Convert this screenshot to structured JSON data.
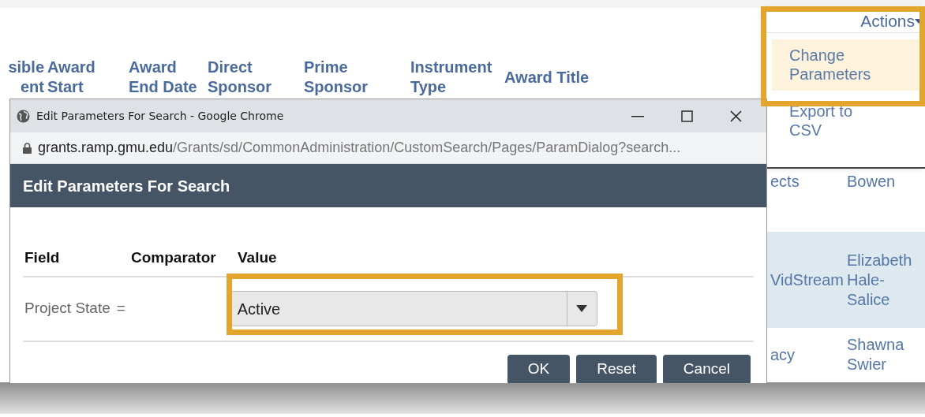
{
  "background_table": {
    "columns": [
      "sible ent",
      "Award Start",
      "Award End Date",
      "Direct Sponsor",
      "Prime Sponsor",
      "Instrument Type",
      "Award Title"
    ],
    "rows": [
      {
        "cells": [
          "ects",
          "Bowen"
        ],
        "selected": false
      },
      {
        "cells": [
          "VidStream",
          "Elizabeth Hale-Salice"
        ],
        "selected": true
      },
      {
        "cells": [
          "acy",
          "Shawna Swier"
        ],
        "selected": false
      }
    ]
  },
  "actions_menu": {
    "label": "Actions",
    "highlighted": true,
    "items": [
      {
        "label": "Change Parameters",
        "selected": true
      },
      {
        "label": "Export to CSV",
        "selected": false
      }
    ]
  },
  "dialog": {
    "window_title": "Edit Parameters For Search - Google Chrome",
    "url_host": "grants.ramp.gmu.edu",
    "url_path": "/Grants/sd/CommonAdministration/CustomSearch/Pages/ParamDialog?search...",
    "header": "Edit Parameters For Search",
    "columns": [
      "Field",
      "Comparator",
      "Value"
    ],
    "params": [
      {
        "field": "Project State",
        "comparator": "=",
        "value": "Active",
        "highlighted": true
      }
    ],
    "buttons": [
      "OK",
      "Reset",
      "Cancel"
    ]
  }
}
